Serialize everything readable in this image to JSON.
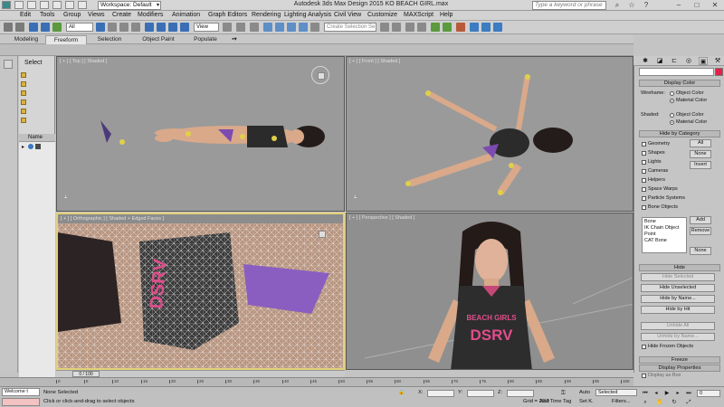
{
  "window": {
    "title": "Autodesk 3ds Max Design 2015    KO BEACH GIRL.max",
    "workspace": "Workspace: Default",
    "search_placeholder": "Type a keyword or phrase"
  },
  "menu": [
    "Edit",
    "Tools",
    "Group",
    "Views",
    "Create",
    "Modifiers",
    "Animation",
    "Graph Editors",
    "Rendering",
    "Lighting Analysis",
    "Civil View",
    "Customize",
    "MAXScript",
    "Help"
  ],
  "toolbar": {
    "selection_filter": "All",
    "ref_coord": "View",
    "named_selection": "Create Selection Se"
  },
  "ribbon_tabs": [
    "Modeling",
    "Freeform",
    "Selection",
    "Object Paint",
    "Populate"
  ],
  "ribbon_active": "Freeform",
  "explorer": {
    "header": "Select",
    "column": "Name"
  },
  "viewports": {
    "top": "[ + ] [ Top ] [ Shaded ]",
    "front": "[ + ] [ Front ] [ Shaded ]",
    "ortho": "[ + ] [ Orthographic ] [ Shaded + Edged Faces ]",
    "persp": "[ + ] [ Perspective ] [ Shaded ]"
  },
  "shirt_text": {
    "line1": "BEACH GIRLS",
    "line2": "DSRV"
  },
  "cmdpanel": {
    "display_color_title": "Display Color",
    "wireframe_label": "Wireframe:",
    "shaded_label": "Shaded:",
    "object_color": "Object Color",
    "material_color": "Material Color",
    "hide_by_category_title": "Hide by Category",
    "categories": [
      "Geometry",
      "Shapes",
      "Lights",
      "Cameras",
      "Helpers",
      "Space Warps",
      "Particle Systems",
      "Bone Objects"
    ],
    "btn_all": "All",
    "btn_none": "None",
    "btn_invert": "Invert",
    "bone_list": [
      "Bone",
      "IK Chain Object",
      "Point",
      "CAT Bone"
    ],
    "btn_add": "Add",
    "btn_remove": "Remove",
    "btn_none2": "None",
    "hide_title": "Hide",
    "hide_buttons": [
      "Hide Selected",
      "Hide Unselected",
      "Hide by Name...",
      "Hide by Hit",
      "Unhide All",
      "Unhide by Name..."
    ],
    "hide_frozen": "Hide Frozen Objects",
    "freeze_title": "Freeze",
    "display_props_title": "Display Properties",
    "display_as_box": "Display as Box"
  },
  "timeline": {
    "slider_label": "0 / 100",
    "ticks": [
      "0",
      "5",
      "10",
      "15",
      "20",
      "25",
      "30",
      "35",
      "40",
      "45",
      "50",
      "55",
      "60",
      "65",
      "70",
      "75",
      "80",
      "85",
      "90",
      "95",
      "100"
    ]
  },
  "status": {
    "maxscript": "Welcome t",
    "selection_status": "None Selected",
    "prompt": "Click or click-and-drag to select objects",
    "x_label": "X:",
    "y_label": "Y:",
    "z_label": "Z:",
    "grid": "Grid = 10.0",
    "add_time_tag": "Add Time Tag",
    "auto": "Auto",
    "set_k": "Set K.",
    "selected": "Selected",
    "filters": "Filters...",
    "frame": "0"
  },
  "colors": {
    "accent_pink": "#e2204a",
    "viewport_bg": "#9a9a9a",
    "active_border": "#e3d17a"
  }
}
